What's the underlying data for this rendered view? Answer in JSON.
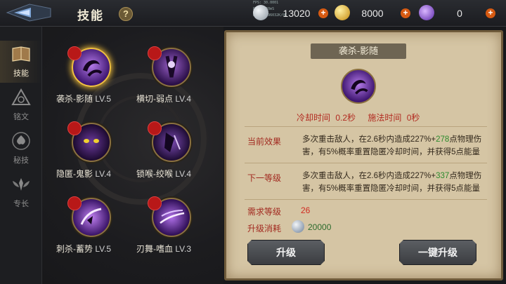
{
  "header": {
    "title": "技能",
    "help": "?",
    "debug_lines": [
      "FPS: 30.0001",
      "Ping: 30mS",
      "Mem: 3196032K/0K"
    ]
  },
  "currencies": [
    {
      "name": "silver",
      "value": "13020",
      "icon": "silver-coin-icon",
      "color": "#b8c0c8"
    },
    {
      "name": "gold",
      "value": "8000",
      "icon": "gold-coin-icon",
      "color": "#e8b820"
    },
    {
      "name": "gem",
      "value": "0",
      "icon": "purple-gem-icon",
      "color": "#8a5ad8"
    }
  ],
  "nav": [
    {
      "label": "技能",
      "icon": "book-icon",
      "active": true
    },
    {
      "label": "铭文",
      "icon": "triangle-rune-icon",
      "active": false
    },
    {
      "label": "秘技",
      "icon": "spade-emblem-icon",
      "active": false
    },
    {
      "label": "专长",
      "icon": "wings-emblem-icon",
      "active": false
    }
  ],
  "skills": [
    {
      "name": "袭杀-影随",
      "level": "LV.5",
      "selected": true
    },
    {
      "name": "横切-弱点",
      "level": "LV.4",
      "selected": false
    },
    {
      "name": "隐匿-鬼影",
      "level": "LV.4",
      "selected": false
    },
    {
      "name": "锁喉-绞喉",
      "level": "LV.4",
      "selected": false
    },
    {
      "name": "刺杀-蓄势",
      "level": "LV.5",
      "selected": false
    },
    {
      "name": "刃舞-嗜血",
      "level": "LV.3",
      "selected": false
    }
  ],
  "detail": {
    "title": "袭杀-影随",
    "cooldown_label": "冷却时间",
    "cooldown_value": "0.2秒",
    "cast_label": "施法时间",
    "cast_value": "0秒",
    "current_label": "当前效果",
    "current_text_a": "多次重击敌人，在2.6秒内造成227%+",
    "current_hl": "278",
    "current_text_b": "点物理伤害，有5%概率重置隐匿冷却时间，并获得5点能量",
    "next_label": "下一等级",
    "next_text_a": "多次重击敌人，在2.6秒内造成227%+",
    "next_hl": "337",
    "next_text_b": "点物理伤害，有5%概率重置隐匿冷却时间，并获得5点能量",
    "req_label": "需求等级",
    "req_value": "26",
    "cost_label": "升级消耗",
    "cost_value": "20000",
    "upgrade_button": "升级",
    "oneclick_button": "一键升级"
  }
}
